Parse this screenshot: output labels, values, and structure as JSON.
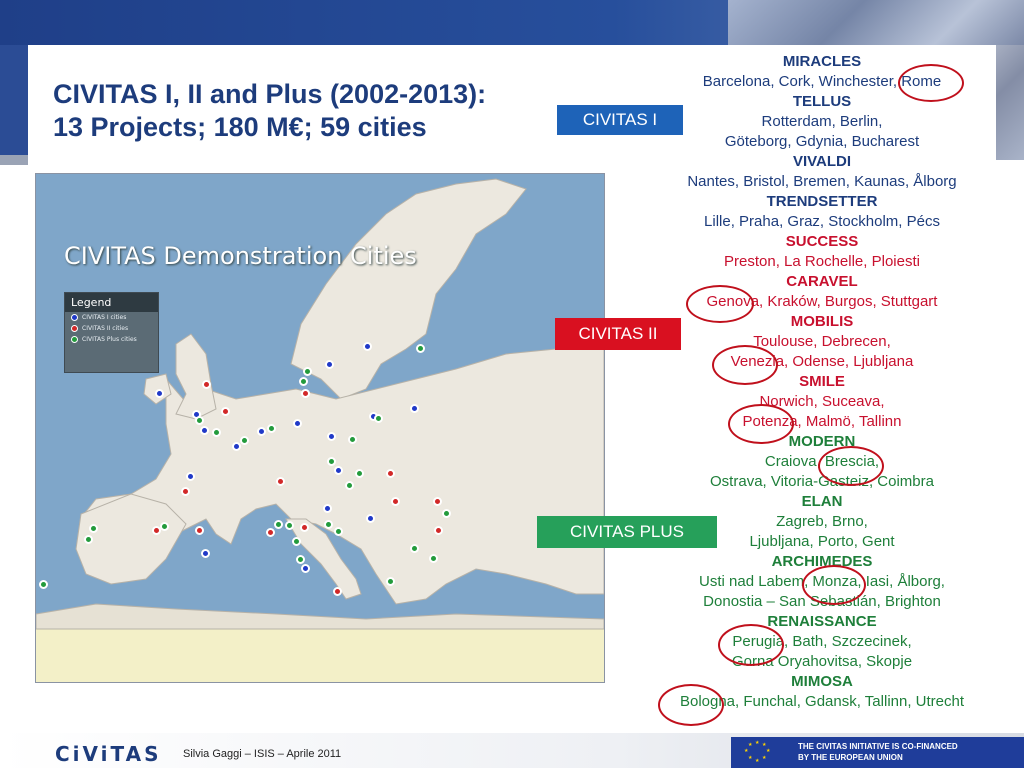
{
  "title": {
    "line1": "CIVITAS I, II and Plus (2002-2013):",
    "line2": "13 Projects;  180 M€;  59 cities"
  },
  "map": {
    "title": "CIVITAS Demonstration Cities",
    "legend": {
      "title": "Legend",
      "items": [
        {
          "label": "CIVITAS I cities",
          "color": "#2039c8"
        },
        {
          "label": "CIVITAS II cities",
          "color": "#d22828"
        },
        {
          "label": "CIVITAS Plus cities",
          "color": "#239b3c"
        }
      ]
    },
    "colors": {
      "sea": "#7fa6c9",
      "land": "#ece8df",
      "border": "#b7b2a8"
    }
  },
  "labels": {
    "civitas1": "CIVITAS  I",
    "civitas2": "CIVITAS II",
    "civitas_plus": "CIVITAS PLUS"
  },
  "projects": [
    {
      "name": "MIRACLES",
      "cities": [
        "Barcelona, Cork, Winchester, Rome"
      ],
      "group": "blue"
    },
    {
      "name": "TELLUS",
      "cities": [
        "Rotterdam, Berlin,",
        "Göteborg, Gdynia, Bucharest"
      ],
      "group": "blue"
    },
    {
      "name": "VIVALDI",
      "cities": [
        "Nantes, Bristol, Bremen, Kaunas, Ålborg"
      ],
      "group": "blue"
    },
    {
      "name": "TRENDSETTER",
      "cities": [
        "Lille, Praha, Graz, Stockholm, Pécs"
      ],
      "group": "blue"
    },
    {
      "name": "SUCCESS",
      "cities": [
        "Preston, La Rochelle, Ploiesti"
      ],
      "group": "red"
    },
    {
      "name": "CARAVEL",
      "cities": [
        "Genova, Kraków, Burgos, Stuttgart"
      ],
      "group": "red"
    },
    {
      "name": "MOBILIS",
      "cities": [
        "Toulouse, Debrecen,",
        "Venezia, Odense, Ljubljana"
      ],
      "group": "red"
    },
    {
      "name": "SMILE",
      "cities": [
        "Norwich, Suceava,",
        "Potenza, Malmö, Tallinn"
      ],
      "group": "red"
    },
    {
      "name": "MODERN",
      "cities": [
        "Craiova, Brescia,",
        "Ostrava, Vitoria-Gasteiz, Coimbra"
      ],
      "group": "green"
    },
    {
      "name": "ELAN",
      "cities": [
        "Zagreb, Brno,",
        "Ljubljana, Porto, Gent"
      ],
      "group": "green"
    },
    {
      "name": "ARCHIMEDES",
      "cities": [
        "Usti nad Labem, Monza, Iasi, Ålborg,",
        "Donostia – San Sebastián, Brighton"
      ],
      "group": "green"
    },
    {
      "name": "RENAISSANCE",
      "cities": [
        "Perugia, Bath, Szczecinek,",
        "Gorna Oryahovitsa, Skopje"
      ],
      "group": "green"
    },
    {
      "name": "MIMOSA",
      "cities": [
        "Bologna, Funchal, Gdansk, Tallinn, Utrecht"
      ],
      "group": "green"
    }
  ],
  "footer": {
    "logo": "CiViTAS",
    "presenter": "Silvia Gaggi – ISIS – Aprile 2011",
    "eu_line1": "THE CIVITAS INITIATIVE IS CO-FINANCED",
    "eu_line2": "BY THE EUROPEAN UNION"
  }
}
